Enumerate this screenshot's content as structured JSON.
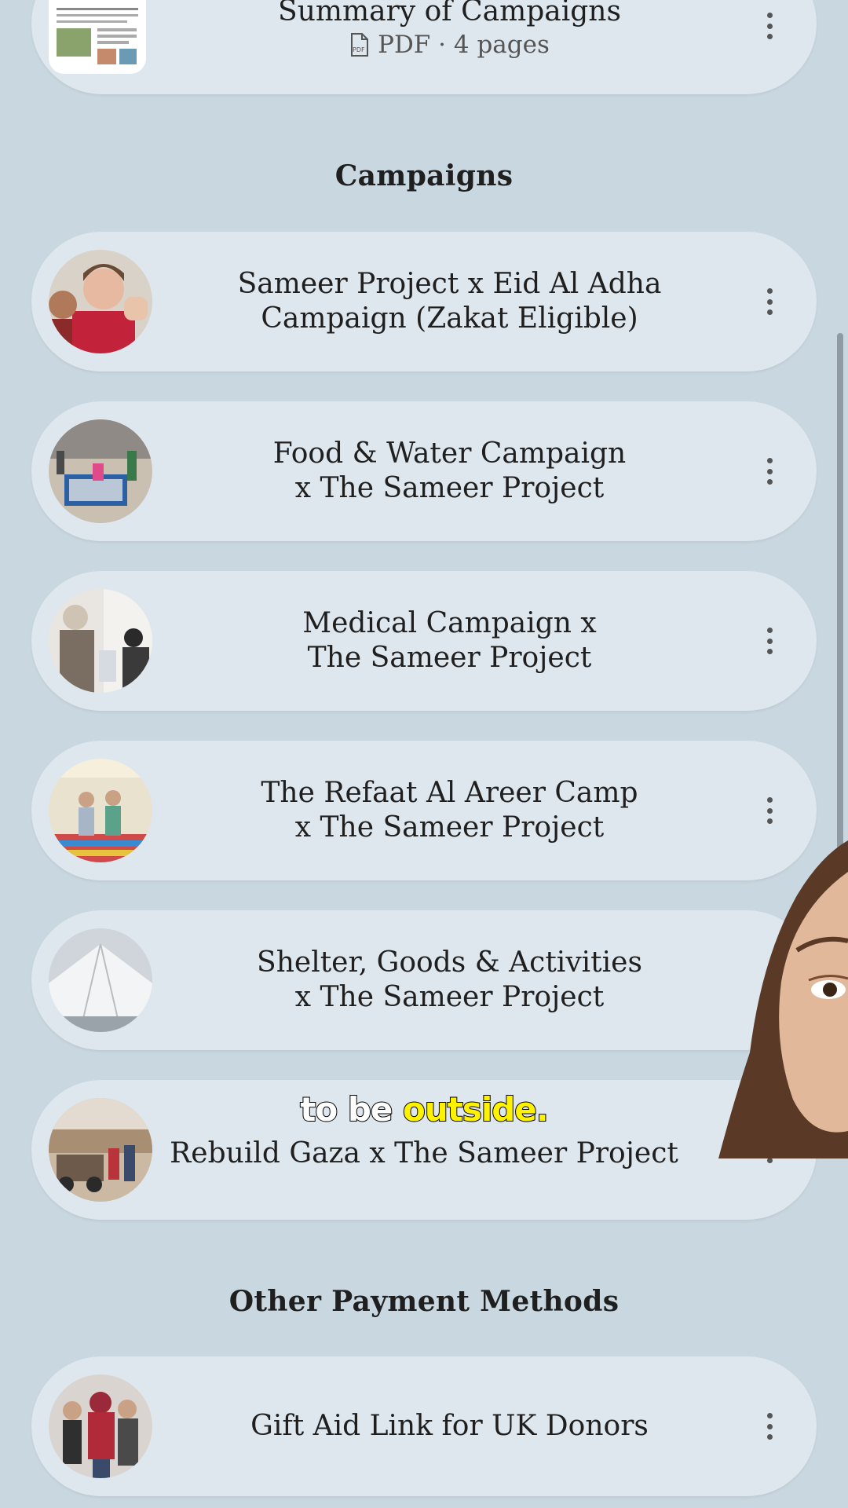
{
  "pdf_card": {
    "title": "Summary of Campaigns",
    "file_type_icon": "pdf-file-icon",
    "meta": "PDF · 4 pages"
  },
  "sections": {
    "campaigns_heading": "Campaigns",
    "other_heading": "Other Payment Methods"
  },
  "campaigns": [
    {
      "line1": "Sameer Project x Eid Al Adha",
      "line2": "Campaign (Zakat Eligible)"
    },
    {
      "line1": "Food & Water Campaign",
      "line2": "x The Sameer Project"
    },
    {
      "line1": "Medical Campaign x",
      "line2": "The Sameer Project"
    },
    {
      "line1": "The Refaat Al Areer Camp",
      "line2": "x The Sameer Project"
    },
    {
      "line1": "Shelter, Goods & Activities",
      "line2": "x The Sameer Project"
    },
    {
      "line1": "Rebuild Gaza x The Sameer Project"
    }
  ],
  "other_links": [
    {
      "label": "Gift Aid Link for UK Donors"
    }
  ],
  "caption": {
    "word1": "to be",
    "word2": "outside."
  },
  "colors": {
    "background": "#c9d7e0",
    "card": "#dfe7ee",
    "caption_highlight": "#fff200"
  }
}
